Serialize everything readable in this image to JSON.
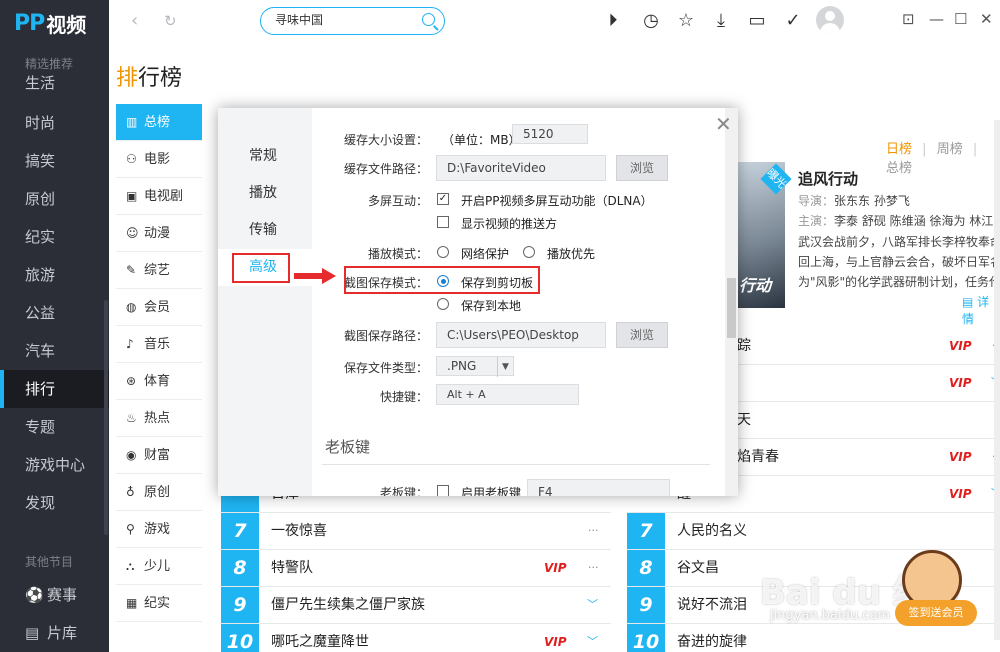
{
  "app": {
    "logo_mark": "PP",
    "logo_text": "视频"
  },
  "sidebar": {
    "section_top": "精选推荐",
    "items": [
      {
        "label": "生活",
        "icon": ""
      },
      {
        "label": "时尚",
        "icon": ""
      },
      {
        "label": "搞笑",
        "icon": ""
      },
      {
        "label": "原创",
        "icon": ""
      },
      {
        "label": "纪实",
        "icon": ""
      },
      {
        "label": "旅游",
        "icon": ""
      },
      {
        "label": "公益",
        "icon": ""
      },
      {
        "label": "汽车",
        "icon": ""
      },
      {
        "label": "排行",
        "icon": ""
      },
      {
        "label": "专题",
        "icon": ""
      },
      {
        "label": "游戏中心",
        "icon": ""
      },
      {
        "label": "发现",
        "icon": ""
      }
    ],
    "section_bottom": "其他节目",
    "extra": [
      {
        "label": "赛事",
        "icon": "soccer-icon"
      },
      {
        "label": "片库",
        "icon": "library-icon"
      }
    ]
  },
  "topbar": {
    "search_value": "寻味中国",
    "icons": [
      "play-icon",
      "history-icon",
      "star-icon",
      "download-icon",
      "message-icon",
      "check-icon"
    ],
    "window_controls": [
      "restore-icon",
      "minimize-icon",
      "maximize-icon",
      "close-icon"
    ]
  },
  "page": {
    "title_first": "排",
    "title_rest": "行榜"
  },
  "categories": [
    {
      "label": "总榜",
      "icon": "bar-chart-icon"
    },
    {
      "label": "电影",
      "icon": "film-icon"
    },
    {
      "label": "电视剧",
      "icon": "tv-icon"
    },
    {
      "label": "动漫",
      "icon": "anime-icon"
    },
    {
      "label": "综艺",
      "icon": "variety-icon"
    },
    {
      "label": "会员",
      "icon": "vip-icon"
    },
    {
      "label": "音乐",
      "icon": "music-icon"
    },
    {
      "label": "体育",
      "icon": "sports-icon"
    },
    {
      "label": "热点",
      "icon": "fire-icon"
    },
    {
      "label": "财富",
      "icon": "wealth-icon"
    },
    {
      "label": "原创",
      "icon": "bulb-icon"
    },
    {
      "label": "游戏",
      "icon": "game-icon"
    },
    {
      "label": "少儿",
      "icon": "kids-icon"
    },
    {
      "label": "纪实",
      "icon": "doc-icon"
    }
  ],
  "left_list": [
    {
      "num": "7",
      "title": "一夜惊喜",
      "vip": "",
      "more": "···"
    },
    {
      "num": "8",
      "title": "特警队",
      "vip": "VIP",
      "more": "···"
    },
    {
      "num": "9",
      "title": "僵尸先生续集之僵尸家族",
      "vip": "",
      "more": "﹀"
    },
    {
      "num": "10",
      "title": "哪吒之魔童降世",
      "vip": "VIP",
      "more": "﹀"
    }
  ],
  "left_partial_title": "日津",
  "right_header": {
    "tab1": "日榜",
    "sep": "|",
    "tab2": "周榜",
    "tab3": "总榜"
  },
  "featured": {
    "ribbon": "曝光",
    "poster_text": "行动",
    "title": "追风行动",
    "director_label": "导演：",
    "director": "张东东 孙梦飞",
    "cast_label": "主演：",
    "cast": "李泰 舒砚 陈维涵 徐海为 林江国",
    "desc1": "武汉会战前夕，八路军排长李梓牧奉命返",
    "desc2": "回上海，与上官静云会合，破坏日军名",
    "desc3": "为\"风影\"的化学武器研制计划，任务代",
    "detail": "详情"
  },
  "right_list": [
    {
      "title": "踪",
      "vip": "VIP",
      "more": "···"
    },
    {
      "title": "",
      "vip": "VIP",
      "more": "﹀"
    },
    {
      "title": "天",
      "vip": "",
      "more": ""
    },
    {
      "title": "焰青春",
      "vip": "VIP",
      "more": "···"
    },
    {
      "title": "醒",
      "vip": "VIP",
      "more": "﹀"
    },
    {
      "num": "7",
      "title": "人民的名义",
      "vip": "",
      "more": ""
    },
    {
      "num": "8",
      "title": "谷文昌",
      "vip": "",
      "more": ""
    },
    {
      "num": "9",
      "title": "说好不流泪",
      "vip": "",
      "more": ""
    },
    {
      "num": "10",
      "title": "奋进的旋律",
      "vip": "",
      "more": ""
    }
  ],
  "watermark": {
    "brand": "Bai du 经验",
    "url": "jingyan.baidu.com",
    "badge": "签到送会员"
  },
  "dialog": {
    "nav": [
      "常规",
      "播放",
      "传输",
      "高级"
    ],
    "cache_size_label": "缓存大小设置：",
    "cache_unit": "（单位：MB）",
    "cache_size_value": "5120",
    "cache_path_label": "缓存文件路径：",
    "cache_path_value": "D:\\FavoriteVideo",
    "browse": "浏览",
    "multiscreen_label": "多屏互动：",
    "dlna_option": "开启PP视频多屏互动功能（DLNA）",
    "push_option": "显示视频的推送方",
    "play_mode_label": "播放模式：",
    "play_mode_opt1": "网络保护",
    "play_mode_opt2": "播放优先",
    "shot_mode_label": "截图保存模式：",
    "shot_mode_opt1": "保存到剪切板",
    "shot_mode_opt2": "保存到本地",
    "shot_path_label": "截图保存路径：",
    "shot_path_value": "C:\\Users\\PEO\\Desktop",
    "file_type_label": "保存文件类型：",
    "file_type_value": ".PNG",
    "hotkey_label": "快捷键：",
    "hotkey_value": "Alt + A",
    "boss_section": "老板键",
    "boss_label": "老板键：",
    "boss_option": "启用老板键",
    "boss_value": "F4"
  }
}
